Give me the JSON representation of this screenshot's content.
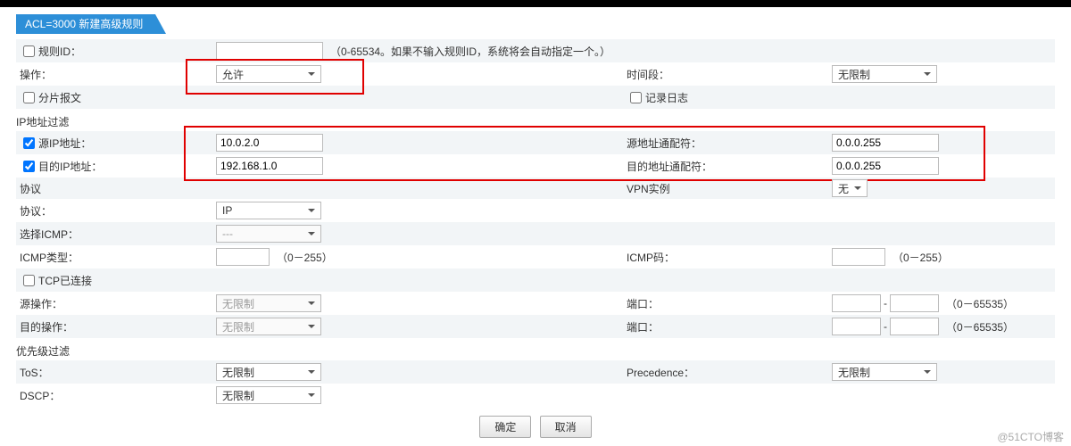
{
  "header": {
    "title": "ACL=3000 新建高级规则"
  },
  "rule_id": {
    "label": "规则ID：",
    "value": "",
    "hint": "（0-65534。如果不输入规则ID，系统将会自动指定一个。）"
  },
  "operation": {
    "label": "操作：",
    "value": "允许"
  },
  "time_range": {
    "label": "时间段：",
    "value": "无限制"
  },
  "fragment": {
    "label": "分片报文"
  },
  "log": {
    "label": "记录日志"
  },
  "section_ip": "IP地址过滤",
  "src_ip": {
    "label": "源IP地址：",
    "value": "10.0.2.0"
  },
  "src_wild": {
    "label": "源地址通配符：",
    "value": "0.0.0.255"
  },
  "dst_ip": {
    "label": "目的IP地址：",
    "value": "192.168.1.0"
  },
  "dst_wild": {
    "label": "目的地址通配符：",
    "value": "0.0.0.255"
  },
  "section_proto": "协议",
  "vpn": {
    "label": "VPN实例",
    "value": "无"
  },
  "protocol": {
    "label": "协议：",
    "value": "IP"
  },
  "icmp_select": {
    "label": "选择ICMP：",
    "value": "---"
  },
  "icmp_type": {
    "label": "ICMP类型：",
    "value": "",
    "hint": "（0－255）"
  },
  "icmp_code": {
    "label": "ICMP码：",
    "value": "",
    "hint": "（0－255）"
  },
  "tcp_established": {
    "label": "TCP已连接"
  },
  "src_op": {
    "label": "源操作：",
    "value": "无限制"
  },
  "src_port": {
    "label": "端口：",
    "from": "",
    "to": "",
    "hint": "（0－65535）"
  },
  "dst_op": {
    "label": "目的操作：",
    "value": "无限制"
  },
  "dst_port": {
    "label": "端口：",
    "from": "",
    "to": "",
    "hint": "（0－65535）"
  },
  "section_prio": "优先级过滤",
  "tos": {
    "label": "ToS：",
    "value": "无限制"
  },
  "precedence": {
    "label": "Precedence：",
    "value": "无限制"
  },
  "dscp": {
    "label": "DSCP：",
    "value": "无限制"
  },
  "buttons": {
    "ok": "确定",
    "cancel": "取消"
  },
  "watermark": "@51CTO博客"
}
